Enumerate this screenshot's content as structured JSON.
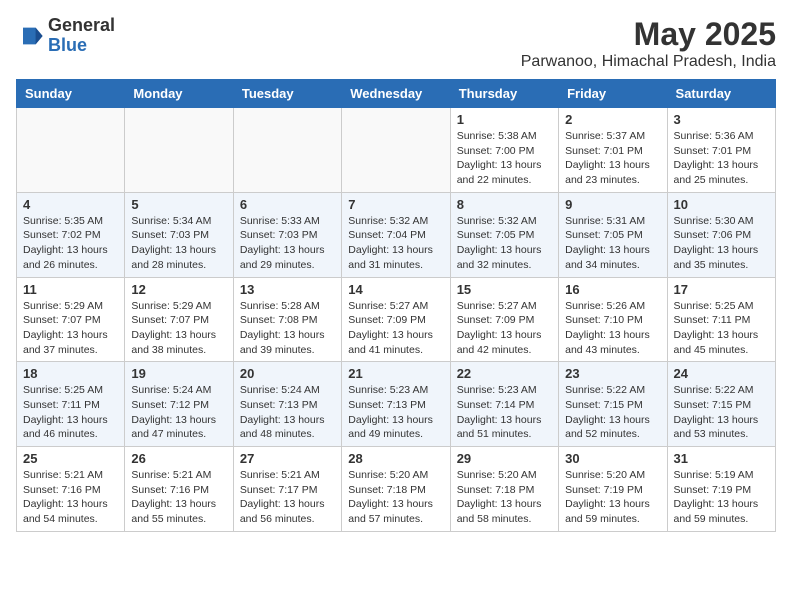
{
  "logo": {
    "general": "General",
    "blue": "Blue"
  },
  "title": "May 2025",
  "subtitle": "Parwanoo, Himachal Pradesh, India",
  "days_of_week": [
    "Sunday",
    "Monday",
    "Tuesday",
    "Wednesday",
    "Thursday",
    "Friday",
    "Saturday"
  ],
  "weeks": [
    [
      {
        "day": "",
        "info": ""
      },
      {
        "day": "",
        "info": ""
      },
      {
        "day": "",
        "info": ""
      },
      {
        "day": "",
        "info": ""
      },
      {
        "day": "1",
        "info": "Sunrise: 5:38 AM\nSunset: 7:00 PM\nDaylight: 13 hours and 22 minutes."
      },
      {
        "day": "2",
        "info": "Sunrise: 5:37 AM\nSunset: 7:01 PM\nDaylight: 13 hours and 23 minutes."
      },
      {
        "day": "3",
        "info": "Sunrise: 5:36 AM\nSunset: 7:01 PM\nDaylight: 13 hours and 25 minutes."
      }
    ],
    [
      {
        "day": "4",
        "info": "Sunrise: 5:35 AM\nSunset: 7:02 PM\nDaylight: 13 hours and 26 minutes."
      },
      {
        "day": "5",
        "info": "Sunrise: 5:34 AM\nSunset: 7:03 PM\nDaylight: 13 hours and 28 minutes."
      },
      {
        "day": "6",
        "info": "Sunrise: 5:33 AM\nSunset: 7:03 PM\nDaylight: 13 hours and 29 minutes."
      },
      {
        "day": "7",
        "info": "Sunrise: 5:32 AM\nSunset: 7:04 PM\nDaylight: 13 hours and 31 minutes."
      },
      {
        "day": "8",
        "info": "Sunrise: 5:32 AM\nSunset: 7:05 PM\nDaylight: 13 hours and 32 minutes."
      },
      {
        "day": "9",
        "info": "Sunrise: 5:31 AM\nSunset: 7:05 PM\nDaylight: 13 hours and 34 minutes."
      },
      {
        "day": "10",
        "info": "Sunrise: 5:30 AM\nSunset: 7:06 PM\nDaylight: 13 hours and 35 minutes."
      }
    ],
    [
      {
        "day": "11",
        "info": "Sunrise: 5:29 AM\nSunset: 7:07 PM\nDaylight: 13 hours and 37 minutes."
      },
      {
        "day": "12",
        "info": "Sunrise: 5:29 AM\nSunset: 7:07 PM\nDaylight: 13 hours and 38 minutes."
      },
      {
        "day": "13",
        "info": "Sunrise: 5:28 AM\nSunset: 7:08 PM\nDaylight: 13 hours and 39 minutes."
      },
      {
        "day": "14",
        "info": "Sunrise: 5:27 AM\nSunset: 7:09 PM\nDaylight: 13 hours and 41 minutes."
      },
      {
        "day": "15",
        "info": "Sunrise: 5:27 AM\nSunset: 7:09 PM\nDaylight: 13 hours and 42 minutes."
      },
      {
        "day": "16",
        "info": "Sunrise: 5:26 AM\nSunset: 7:10 PM\nDaylight: 13 hours and 43 minutes."
      },
      {
        "day": "17",
        "info": "Sunrise: 5:25 AM\nSunset: 7:11 PM\nDaylight: 13 hours and 45 minutes."
      }
    ],
    [
      {
        "day": "18",
        "info": "Sunrise: 5:25 AM\nSunset: 7:11 PM\nDaylight: 13 hours and 46 minutes."
      },
      {
        "day": "19",
        "info": "Sunrise: 5:24 AM\nSunset: 7:12 PM\nDaylight: 13 hours and 47 minutes."
      },
      {
        "day": "20",
        "info": "Sunrise: 5:24 AM\nSunset: 7:13 PM\nDaylight: 13 hours and 48 minutes."
      },
      {
        "day": "21",
        "info": "Sunrise: 5:23 AM\nSunset: 7:13 PM\nDaylight: 13 hours and 49 minutes."
      },
      {
        "day": "22",
        "info": "Sunrise: 5:23 AM\nSunset: 7:14 PM\nDaylight: 13 hours and 51 minutes."
      },
      {
        "day": "23",
        "info": "Sunrise: 5:22 AM\nSunset: 7:15 PM\nDaylight: 13 hours and 52 minutes."
      },
      {
        "day": "24",
        "info": "Sunrise: 5:22 AM\nSunset: 7:15 PM\nDaylight: 13 hours and 53 minutes."
      }
    ],
    [
      {
        "day": "25",
        "info": "Sunrise: 5:21 AM\nSunset: 7:16 PM\nDaylight: 13 hours and 54 minutes."
      },
      {
        "day": "26",
        "info": "Sunrise: 5:21 AM\nSunset: 7:16 PM\nDaylight: 13 hours and 55 minutes."
      },
      {
        "day": "27",
        "info": "Sunrise: 5:21 AM\nSunset: 7:17 PM\nDaylight: 13 hours and 56 minutes."
      },
      {
        "day": "28",
        "info": "Sunrise: 5:20 AM\nSunset: 7:18 PM\nDaylight: 13 hours and 57 minutes."
      },
      {
        "day": "29",
        "info": "Sunrise: 5:20 AM\nSunset: 7:18 PM\nDaylight: 13 hours and 58 minutes."
      },
      {
        "day": "30",
        "info": "Sunrise: 5:20 AM\nSunset: 7:19 PM\nDaylight: 13 hours and 59 minutes."
      },
      {
        "day": "31",
        "info": "Sunrise: 5:19 AM\nSunset: 7:19 PM\nDaylight: 13 hours and 59 minutes."
      }
    ]
  ]
}
